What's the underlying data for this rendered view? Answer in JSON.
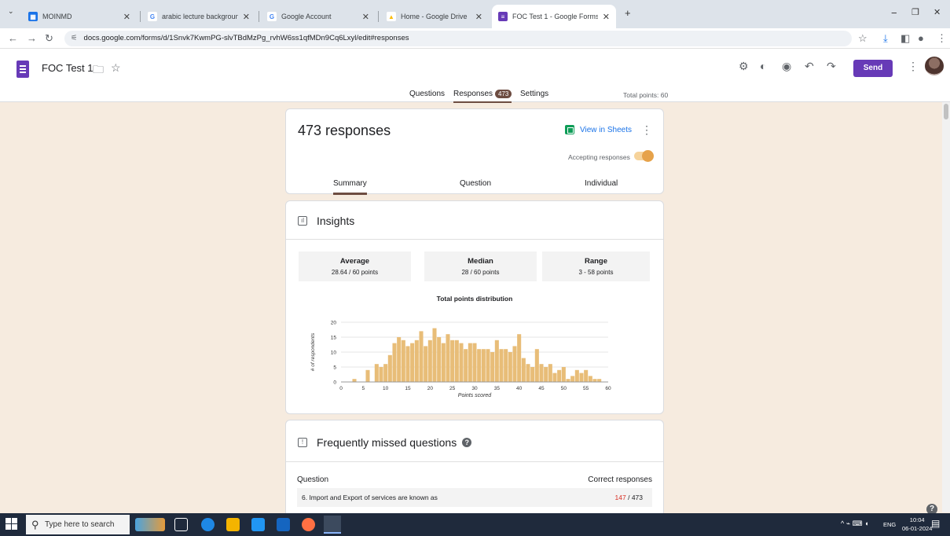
{
  "browser": {
    "tabs": [
      {
        "title": "MOINMD",
        "color": "#1a73e8",
        "glyph": "▦"
      },
      {
        "title": "arabic lecture background imag",
        "color": "#4285f4",
        "glyph": "G"
      },
      {
        "title": "Google Account",
        "color": "#4285f4",
        "glyph": "G"
      },
      {
        "title": "Home - Google Drive",
        "color": "#fbbc04",
        "glyph": "▲"
      },
      {
        "title": "FOC Test 1 - Google Forms",
        "color": "#673ab7",
        "glyph": "≡"
      }
    ],
    "new_tab": "+",
    "url": "docs.google.com/forms/d/1Snvk7KwmPG-slvTBdMzPg_rvhW6ss1qfMDn9Cq6Lxyl/edit#responses"
  },
  "form": {
    "title": "FOC Test 1",
    "send_label": "Send",
    "tabs": {
      "questions": "Questions",
      "responses": "Responses",
      "responses_count": "473",
      "settings": "Settings"
    },
    "total_points": "Total points: 60"
  },
  "responses_card": {
    "heading": "473 responses",
    "view_in_sheets": "View in Sheets",
    "accepting": "Accepting responses",
    "accepting_on": true,
    "tabs": {
      "summary": "Summary",
      "question": "Question",
      "individual": "Individual"
    }
  },
  "insights": {
    "title": "Insights",
    "average": {
      "label": "Average",
      "value": "28.64 / 60 points"
    },
    "median": {
      "label": "Median",
      "value": "28 / 60 points"
    },
    "range": {
      "label": "Range",
      "value": "3 - 58 points"
    }
  },
  "chart_data": {
    "type": "bar",
    "title": "Total points distribution",
    "xlabel": "Points scored",
    "ylabel": "# of respondents",
    "xlim": [
      0,
      60
    ],
    "ylim": [
      0,
      20
    ],
    "x_ticks": [
      0,
      5,
      10,
      15,
      20,
      25,
      30,
      35,
      40,
      45,
      50,
      55,
      60
    ],
    "y_ticks": [
      0,
      5,
      10,
      15,
      20
    ],
    "color": "#e8bd78",
    "x": [
      3,
      6,
      8,
      9,
      10,
      11,
      12,
      13,
      14,
      15,
      16,
      17,
      18,
      19,
      20,
      21,
      22,
      23,
      24,
      25,
      26,
      27,
      28,
      29,
      30,
      31,
      32,
      33,
      34,
      35,
      36,
      37,
      38,
      39,
      40,
      41,
      42,
      43,
      44,
      45,
      46,
      47,
      48,
      49,
      50,
      51,
      52,
      53,
      54,
      55,
      56,
      57,
      58
    ],
    "values": [
      1,
      4,
      6,
      5,
      6,
      9,
      13,
      15,
      14,
      12,
      13,
      14,
      17,
      12,
      14,
      18,
      15,
      13,
      16,
      14,
      14,
      13,
      11,
      13,
      13,
      11,
      11,
      11,
      10,
      14,
      11,
      11,
      10,
      12,
      16,
      8,
      6,
      5,
      11,
      6,
      5,
      6,
      3,
      4,
      5,
      1,
      2,
      4,
      3,
      4,
      2,
      1,
      1
    ]
  },
  "missed": {
    "title": "Frequently missed questions",
    "col_question": "Question",
    "col_correct": "Correct responses",
    "rows": [
      {
        "question": "6. Import and Export of services are known as",
        "correct": "147",
        "total": "/ 473"
      }
    ]
  },
  "taskbar": {
    "search_placeholder": "Type here to search",
    "lang": "ENG",
    "time": "10:04",
    "date": "06-01-2024"
  }
}
